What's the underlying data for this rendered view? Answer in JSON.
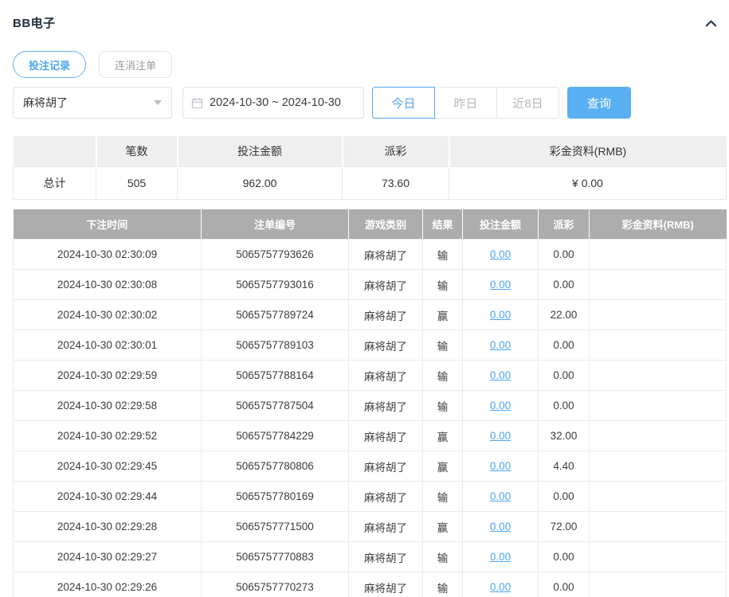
{
  "panel": {
    "title": "BB电子"
  },
  "tabs": [
    {
      "label": "投注记录",
      "active": true
    },
    {
      "label": "连消注单",
      "active": false
    }
  ],
  "filters": {
    "game_select": {
      "value": "麻将胡了"
    },
    "date_range": {
      "value": "2024-10-30 ~ 2024-10-30"
    },
    "quick_buttons": [
      {
        "label": "今日",
        "active": true
      },
      {
        "label": "昨日",
        "active": false
      },
      {
        "label": "近8日",
        "active": false
      }
    ],
    "search_button": {
      "label": "查询"
    }
  },
  "summary_table": {
    "headers": [
      "",
      "笔数",
      "投注金额",
      "派彩",
      "彩金资料(RMB)"
    ],
    "row": {
      "label": "总计",
      "count": "505",
      "bet_amount": "962.00",
      "payout": "73.60",
      "bonus": "¥ 0.00"
    }
  },
  "records_table": {
    "headers": [
      "下注时间",
      "注单编号",
      "游戏类别",
      "结果",
      "投注金额",
      "派彩",
      "彩金资料(RMB)"
    ],
    "rows": [
      {
        "time": "2024-10-30 02:30:09",
        "bet_id": "5065757793626",
        "game": "麻将胡了",
        "result": "输",
        "bet_amount": "0.00",
        "payout": "0.00",
        "bonus": ""
      },
      {
        "time": "2024-10-30 02:30:08",
        "bet_id": "5065757793016",
        "game": "麻将胡了",
        "result": "输",
        "bet_amount": "0.00",
        "payout": "0.00",
        "bonus": ""
      },
      {
        "time": "2024-10-30 02:30:02",
        "bet_id": "5065757789724",
        "game": "麻将胡了",
        "result": "赢",
        "bet_amount": "0.00",
        "payout": "22.00",
        "bonus": ""
      },
      {
        "time": "2024-10-30 02:30:01",
        "bet_id": "5065757789103",
        "game": "麻将胡了",
        "result": "输",
        "bet_amount": "0.00",
        "payout": "0.00",
        "bonus": ""
      },
      {
        "time": "2024-10-30 02:29:59",
        "bet_id": "5065757788164",
        "game": "麻将胡了",
        "result": "输",
        "bet_amount": "0.00",
        "payout": "0.00",
        "bonus": ""
      },
      {
        "time": "2024-10-30 02:29:58",
        "bet_id": "5065757787504",
        "game": "麻将胡了",
        "result": "输",
        "bet_amount": "0.00",
        "payout": "0.00",
        "bonus": ""
      },
      {
        "time": "2024-10-30 02:29:52",
        "bet_id": "5065757784229",
        "game": "麻将胡了",
        "result": "赢",
        "bet_amount": "0.00",
        "payout": "32.00",
        "bonus": ""
      },
      {
        "time": "2024-10-30 02:29:45",
        "bet_id": "5065757780806",
        "game": "麻将胡了",
        "result": "赢",
        "bet_amount": "0.00",
        "payout": "4.40",
        "bonus": ""
      },
      {
        "time": "2024-10-30 02:29:44",
        "bet_id": "5065757780169",
        "game": "麻将胡了",
        "result": "输",
        "bet_amount": "0.00",
        "payout": "0.00",
        "bonus": ""
      },
      {
        "time": "2024-10-30 02:29:28",
        "bet_id": "5065757771500",
        "game": "麻将胡了",
        "result": "赢",
        "bet_amount": "0.00",
        "payout": "72.00",
        "bonus": ""
      },
      {
        "time": "2024-10-30 02:29:27",
        "bet_id": "5065757770883",
        "game": "麻将胡了",
        "result": "输",
        "bet_amount": "0.00",
        "payout": "0.00",
        "bonus": ""
      },
      {
        "time": "2024-10-30 02:29:26",
        "bet_id": "5065757770273",
        "game": "麻将胡了",
        "result": "输",
        "bet_amount": "0.00",
        "payout": "0.00",
        "bonus": ""
      }
    ]
  },
  "colors": {
    "accent": "#54a8f0",
    "search_button_bg": "#5ab0f2",
    "table_header_bg": "#adadad",
    "summary_header_bg": "#efefef"
  }
}
